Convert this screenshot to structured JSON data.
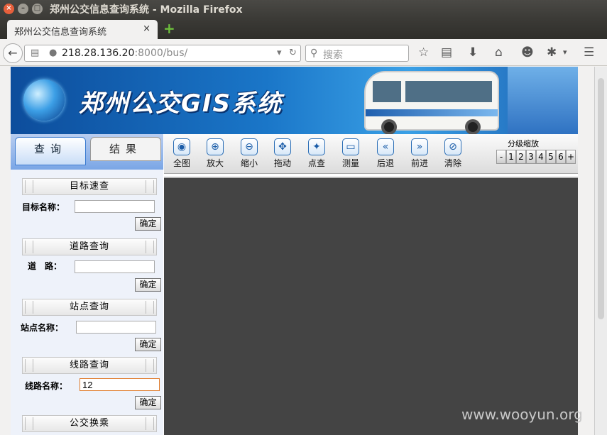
{
  "window": {
    "title": "郑州公交信息查询系统 - Mozilla Firefox"
  },
  "tab": {
    "title": "郑州公交信息查询系统",
    "close": "×",
    "new": "+"
  },
  "nav": {
    "url_host": "218.28.136.20",
    "url_rest": ":8000/bus/",
    "search_placeholder": "搜索"
  },
  "banner": {
    "title": "郑州公交GIS系统"
  },
  "left_tabs": {
    "query": "查询",
    "result": "结果"
  },
  "sections": {
    "target": {
      "title": "目标速查",
      "label": "目标名称：",
      "value": "",
      "ok": "确定"
    },
    "road": {
      "title": "道路查询",
      "label": "道　路：",
      "value": "",
      "ok": "确定"
    },
    "stop": {
      "title": "站点查询",
      "label": "站点名称：",
      "value": "",
      "ok": "确定"
    },
    "line": {
      "title": "线路查询",
      "label": "线路名称：",
      "value": "12",
      "ok": "确定"
    },
    "transfer": {
      "title": "公交换乘"
    }
  },
  "toolbar": {
    "full": "全图",
    "zoom_in": "放大",
    "zoom_out": "缩小",
    "pan": "拖动",
    "identify": "点查",
    "measure": "测量",
    "back": "后退",
    "forward": "前进",
    "clear": "清除"
  },
  "zoom": {
    "label": "分级缩放",
    "levels": [
      "-",
      "1",
      "2",
      "3",
      "4",
      "5",
      "6",
      "+"
    ]
  },
  "watermark": "www.wooyun.org"
}
